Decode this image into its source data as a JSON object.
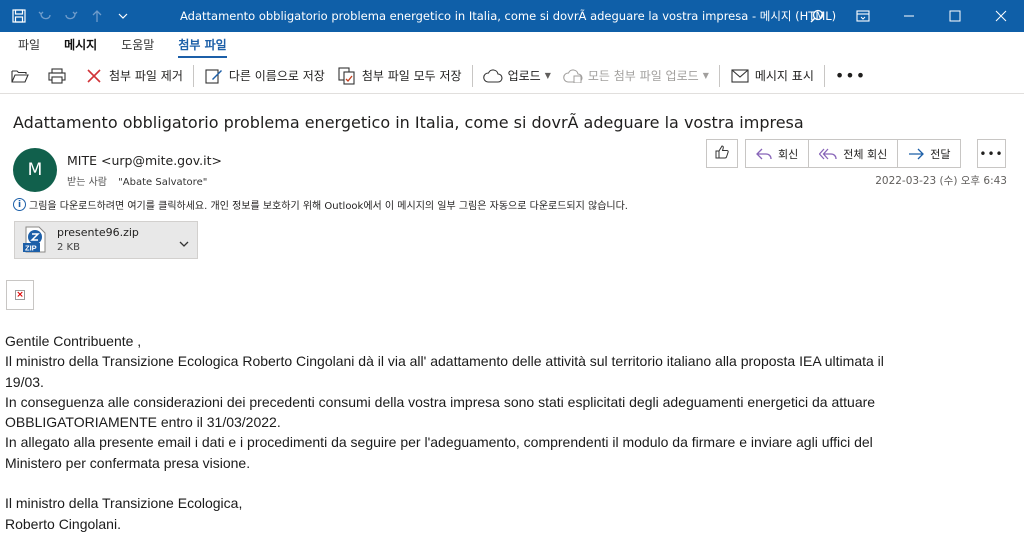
{
  "window": {
    "title": "Adattamento  obbligatorio  problema energetico in Italia, come si dovrÃ   adeguare la vostra impresa  -  메시지 (HTML)"
  },
  "tabs": [
    {
      "label": "파일"
    },
    {
      "label": "메시지"
    },
    {
      "label": "도움말"
    },
    {
      "label": "첨부 파일"
    }
  ],
  "toolbar": {
    "remove_attachment": "첨부 파일 제거",
    "save_as": "다른 이름으로 저장",
    "save_all": "첨부 파일 모두 저장",
    "upload": "업로드",
    "upload_all": "모든 첨부 파일 업로드",
    "show_message": "메시지 표시"
  },
  "message": {
    "subject": "Adattamento  obbligatorio  problema energetico in Italia, come si dovrÃ   adeguare la vostra impresa",
    "avatar_initial": "M",
    "sender": "MITE <urp@mite.gov.it>",
    "recipient_label": "받는 사람",
    "recipient": "\"Abate Salvatore\"",
    "date": "2022-03-23 (수) 오후 6:43",
    "actions": {
      "reply": "회신",
      "reply_all": "전체 회신",
      "forward": "전달"
    },
    "info_bar": "그림을 다운로드하려면 여기를 클릭하세요. 개인 정보를 보호하기 위해 Outlook에서 이 메시지의 일부 그림은 자동으로 다운로드되지 않습니다.",
    "attachment": {
      "name": "presente96.zip",
      "size": "2 KB",
      "type_label": "ZIP"
    },
    "body": {
      "line1": "Gentile  Contribuente  ,",
      "line2": "Il ministro  della Transizione Ecologica Roberto Cingolani  dà il via all'  adattamento delle  attività sul territorio italiano  alla proposta IEA ultimata il",
      "line3": "19/03.",
      "line4": "In conseguenza alle considerazioni dei precedenti  consumi della vostra impresa  sono stati esplicitati  degli adeguamenti  energetici  da attuare",
      "line5": "OBBLIGATORIAMENTE  entro il 31/03/2022.",
      "line6": "In allegato alla presente email i dati e i procedimenti  da seguire per l'adeguamento,  comprendenti  il modulo da firmare e inviare agli uffici del",
      "line7": "Ministero per confermata presa visione.",
      "line8": "Il ministro  della Transizione Ecologica,",
      "line9": "Roberto Cingolani."
    }
  },
  "colors": {
    "titlebar": "#0f5fa8",
    "accent": "#1c5fa8",
    "avatar": "#11604c"
  }
}
